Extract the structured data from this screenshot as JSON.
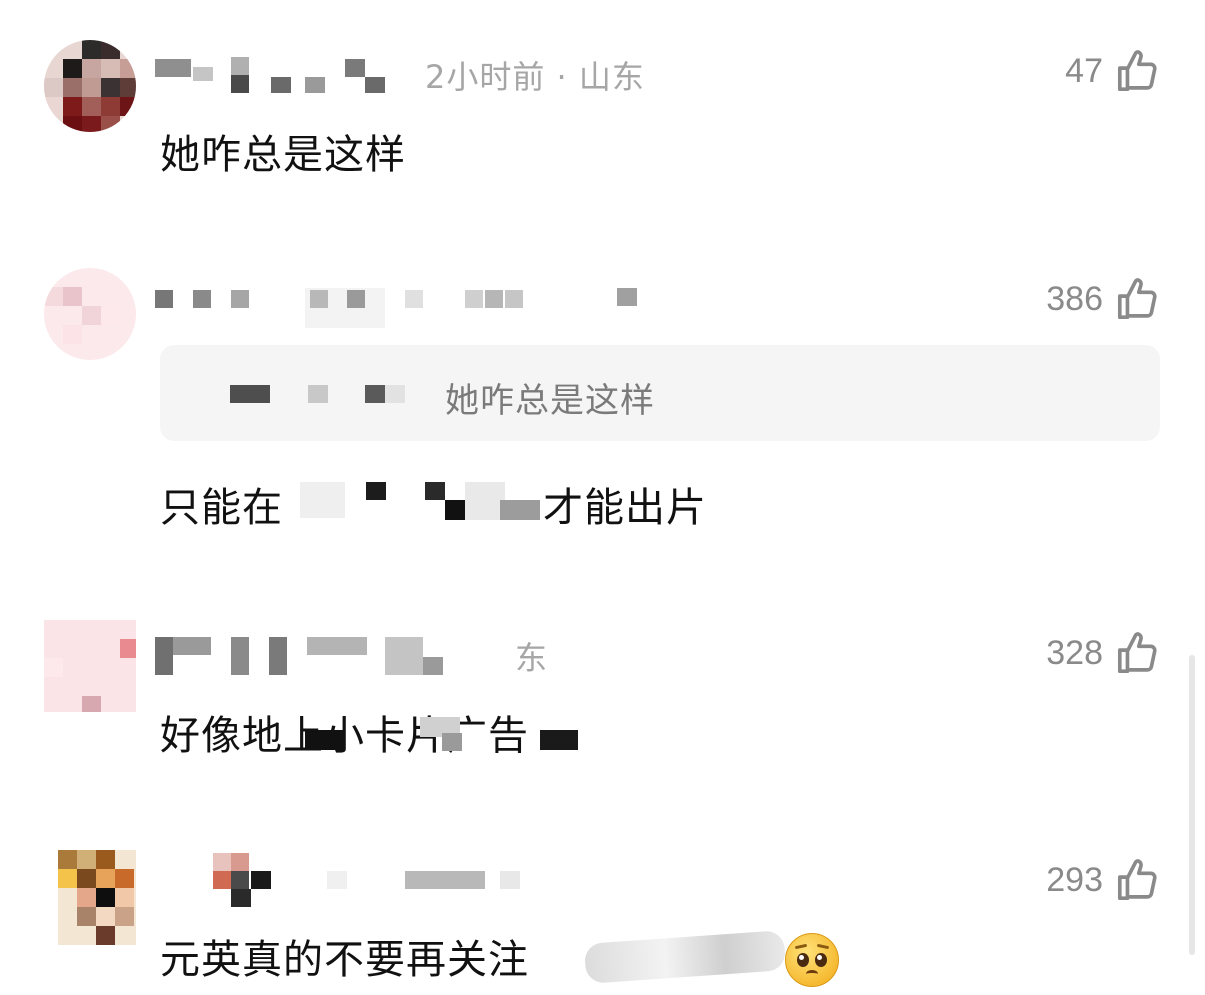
{
  "comments": [
    {
      "meta": "2小时前 · 山东",
      "text": "她咋总是这样",
      "likes": "47"
    },
    {
      "quote": "她咋总是这样",
      "text_start": "只能在",
      "text_end": "才能出片",
      "likes": "386"
    },
    {
      "meta": "东",
      "text": "好像地上小卡片广告",
      "likes": "328"
    },
    {
      "text": "元英真的不要再关注",
      "emoji": "pleading-face",
      "likes": "293"
    }
  ],
  "icons": {
    "like": "thumbs-up-icon"
  },
  "colors": {
    "text": "#111111",
    "meta": "#a6a6a6",
    "like_count": "#8a8a8a",
    "quote_bg": "#f5f5f5"
  }
}
